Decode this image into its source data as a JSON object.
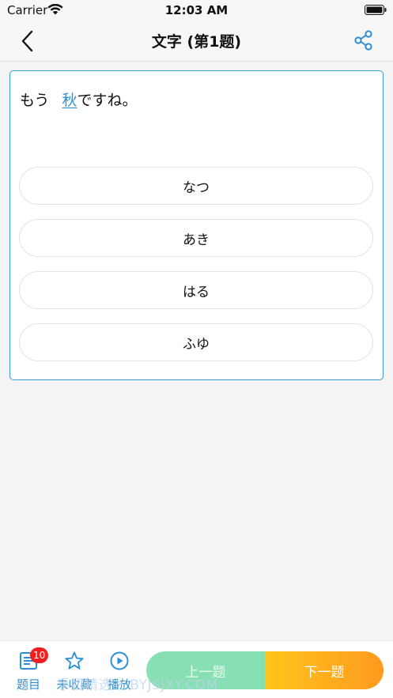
{
  "status_bar": {
    "carrier": "Carrier",
    "time": "12:03 AM",
    "wifi_icon": "wifi-icon",
    "battery_icon": "battery-icon"
  },
  "nav": {
    "title": "文字 (第1题)",
    "back_icon": "chevron-left-icon",
    "share_icon": "share-icon"
  },
  "question": {
    "prefix": "もう",
    "target": "秋",
    "suffix": "ですね。",
    "options": [
      "なつ",
      "あき",
      "はる",
      "ふゆ"
    ]
  },
  "toolbar": {
    "questions_label": "题目",
    "questions_badge": "10",
    "favorite_label": "未收藏",
    "play_label": "播放",
    "prev_label": "上一题",
    "next_label": "下一题"
  },
  "watermark": "手机精选 • BYJSJXY.COM",
  "colors": {
    "accent": "#2c8fd6",
    "card_border": "#3a9bd9",
    "prev_button": "#86e0b3",
    "next_start": "#ffc51c",
    "next_end": "#ff9a1e",
    "badge": "#f02020"
  }
}
